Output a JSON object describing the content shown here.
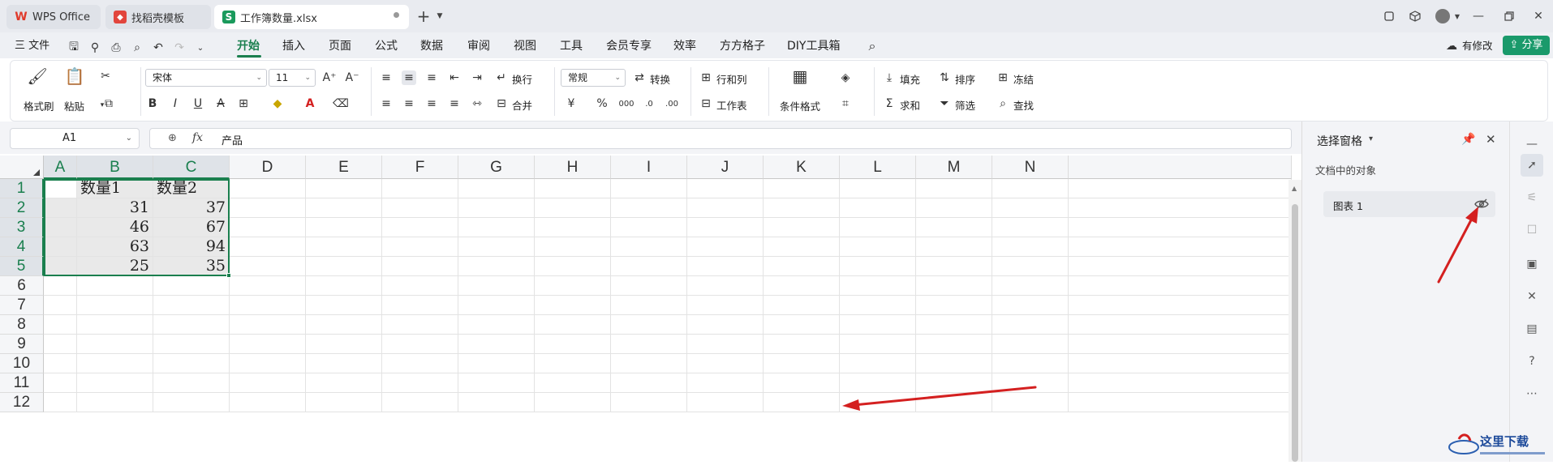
{
  "tabs": [
    {
      "label": "WPS Office",
      "icon": "wps-logo-icon",
      "state": "inactive"
    },
    {
      "label": "找稻壳模板",
      "icon": "docer-icon",
      "state": "inactive"
    },
    {
      "label": "工作簿数量.xlsx",
      "icon": "spreadsheet-s-icon",
      "icon_text": "S",
      "state": "active"
    }
  ],
  "tab_new": "+",
  "menu": {
    "file": "三 文件",
    "items": [
      "开始",
      "插入",
      "页面",
      "公式",
      "数据",
      "审阅",
      "视图",
      "工具",
      "会员专享",
      "效率",
      "方方格子",
      "DIY工具箱"
    ],
    "active": "开始",
    "has_changes": "有修改",
    "share": "分享"
  },
  "ribbon": {
    "format_painter": "格式刷",
    "paste": "粘贴",
    "font_name": "宋体",
    "font_size": "11",
    "wrap": "换行",
    "merge": "合并",
    "number_format": "常规",
    "convert": "转换",
    "rows_cols": "行和列",
    "worksheet": "工作表",
    "conditional_format": "条件格式",
    "fill": "填充",
    "sort": "排序",
    "freeze": "冻结",
    "sum": "求和",
    "filter": "筛选",
    "find": "查找",
    "currency": "¥",
    "percent": "%"
  },
  "formula_bar": {
    "name_box": "A1",
    "fx": "fx",
    "content": "产品"
  },
  "sheet": {
    "columns": [
      "A",
      "B",
      "C",
      "D",
      "E",
      "F",
      "G",
      "H",
      "I",
      "J",
      "K",
      "L",
      "M",
      "N"
    ],
    "rows": [
      "1",
      "2",
      "3",
      "4",
      "5",
      "6",
      "7",
      "8",
      "9",
      "10",
      "11",
      "12"
    ],
    "cells": {
      "B1": "数量1",
      "C1": "数量2",
      "B2": "31",
      "C2": "37",
      "B3": "46",
      "C3": "67",
      "B4": "63",
      "C4": "94",
      "B5": "25",
      "C5": "35"
    }
  },
  "selection_pane": {
    "title": "选择窗格",
    "subtitle": "文档中的对象",
    "items": [
      {
        "label": "图表 1",
        "visibility_icon": "eye-hidden-icon"
      }
    ]
  },
  "colors": {
    "accent": "#1a7f4e",
    "annotation_arrow": "#d42020"
  }
}
